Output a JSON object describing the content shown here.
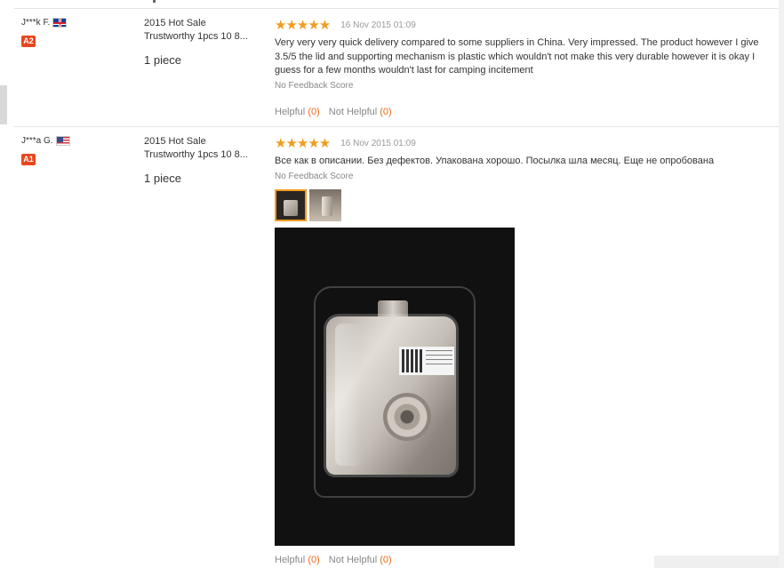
{
  "reviews": [
    {
      "buyer": "J***k F.",
      "country_flag": "uk-flag-icon",
      "level": "A2",
      "product_line1": "2015 Hot Sale",
      "product_line2": "Trustworthy 1pcs 10 8...",
      "quantity": "1 piece",
      "stars": "★★★★★",
      "rating": 5,
      "date": "16 Nov 2015 01:09",
      "text": "Very very very quick delivery compared to some suppliers in China. Very impressed. The product however I give 3.5/5 the lid and supporting mechanism is plastic which wouldn't not make this very durable however it is okay I guess for a few months wouldn't last for camping incitement",
      "feedback_score": "No Feedback Score",
      "helpful_label": "Helpful",
      "helpful_count": "(0)",
      "not_helpful_label": "Not Helpful",
      "not_helpful_count": "(0)"
    },
    {
      "buyer": "J***a G.",
      "country_flag": "us-flag-icon",
      "level": "A1",
      "product_line1": "2015 Hot Sale",
      "product_line2": "Trustworthy 1pcs 10 8...",
      "quantity": "1 piece",
      "stars": "★★★★★",
      "rating": 5,
      "date": "16 Nov 2015 01:09",
      "text": "Все как в описании. Без дефектов. Упакована хорошо. Посылка шла месяц. Еще не опробована",
      "feedback_score": "No Feedback Score",
      "helpful_label": "Helpful",
      "helpful_count": "(0)",
      "not_helpful_label": "Not Helpful",
      "not_helpful_count": "(0)"
    }
  ],
  "colors": {
    "star": "#f29b1f",
    "level_badge": "#e8461e",
    "count": "#f06a1c"
  }
}
